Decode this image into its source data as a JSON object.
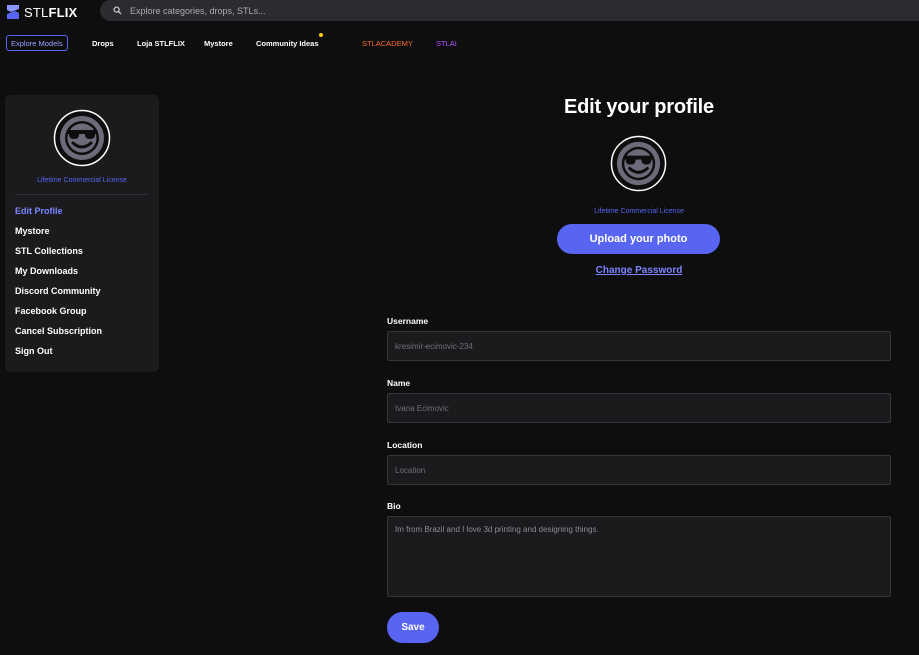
{
  "brand": {
    "name_light": "STL",
    "name_bold": "FLIX",
    "accent": "#5865f2"
  },
  "search": {
    "placeholder": "Explore categories, drops, STLs..."
  },
  "nav": {
    "items": [
      {
        "label": "Explore Models",
        "active": true
      },
      {
        "label": "Drops"
      },
      {
        "label": "Loja STLFLIX"
      },
      {
        "label": "Mystore"
      },
      {
        "label": "Community Ideas",
        "notification": true
      },
      {
        "label": "STLACADEMY",
        "color": "#ff6a2b"
      },
      {
        "label": "STLAI",
        "color": "#b055ff"
      }
    ]
  },
  "sidebar": {
    "avatar_icon": "sunglasses-smiley-icon",
    "license": "Lifetime Commercial License",
    "menu": [
      {
        "label": "Edit Profile",
        "active": true
      },
      {
        "label": "Mystore"
      },
      {
        "label": "STL Collections"
      },
      {
        "label": "My Downloads"
      },
      {
        "label": "Discord Community"
      },
      {
        "label": "Facebook Group"
      },
      {
        "label": "Cancel Subscription"
      },
      {
        "label": "Sign Out"
      }
    ]
  },
  "profile": {
    "title": "Edit your profile",
    "license": "Lifetime Commercial License",
    "upload_label": "Upload your photo",
    "change_password_label": "Change Password",
    "fields": {
      "username": {
        "label": "Username",
        "placeholder": "kresimir-ecimovic-234"
      },
      "name": {
        "label": "Name",
        "placeholder": "Ivana Ecimovic"
      },
      "location": {
        "label": "Location",
        "placeholder": "Location"
      },
      "bio": {
        "label": "Bio",
        "value": "Im from Brazil and I love 3d printing and designing things."
      }
    },
    "save_label": "Save"
  }
}
